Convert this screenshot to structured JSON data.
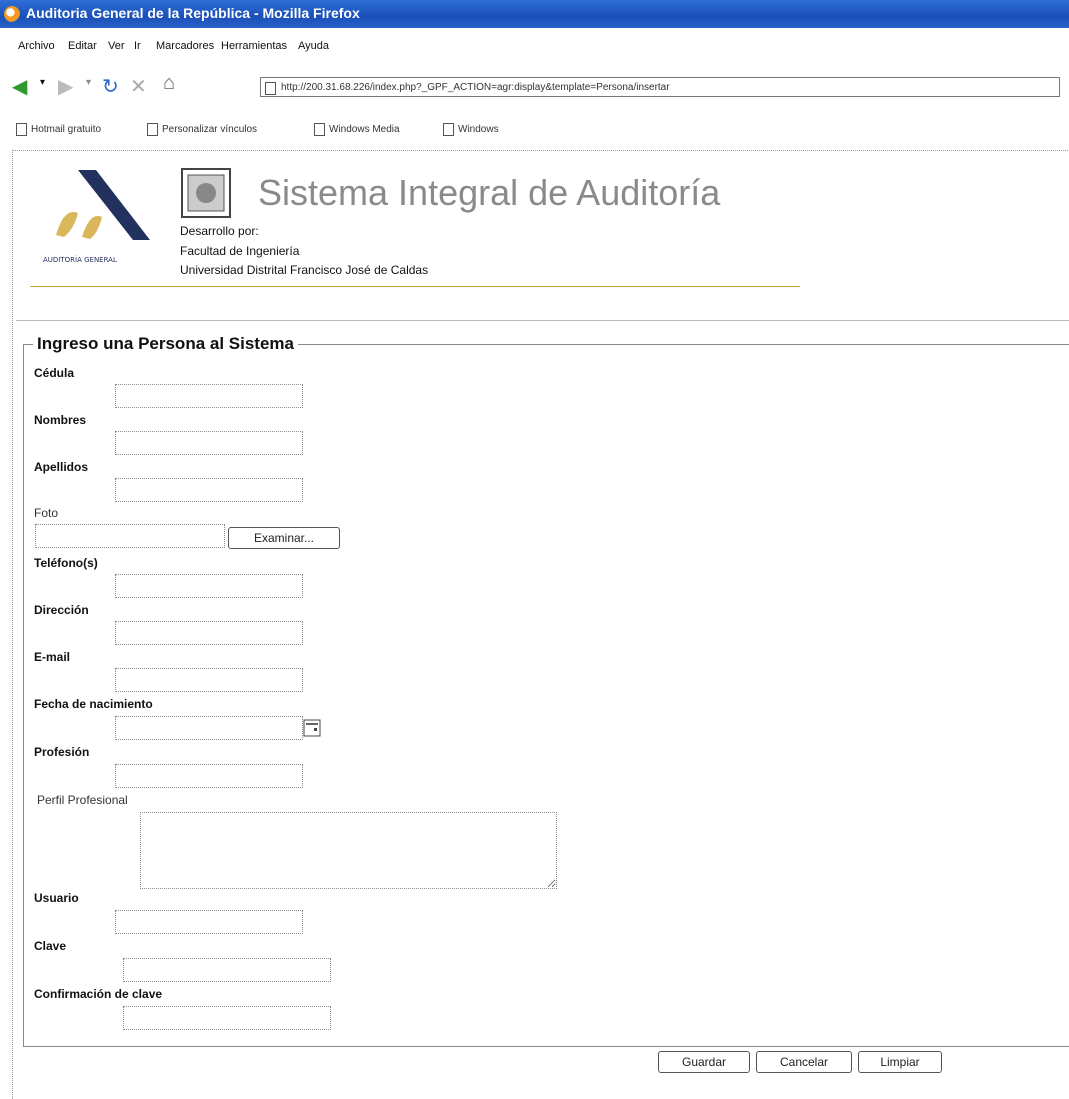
{
  "window": {
    "title": "Auditoria General de la República - Mozilla Firefox"
  },
  "menu": [
    "Archivo",
    "Editar",
    "Ver",
    "Ir",
    "Marcadores",
    "Herramientas",
    "Ayuda"
  ],
  "nav": {
    "url": "http://200.31.68.226/index.php?_GPF_ACTION=agr:display&template=Persona/insertar"
  },
  "bookmarks": [
    "Hotmail gratuito",
    "Personalizar vínculos",
    "Windows Media",
    "Windows"
  ],
  "header": {
    "logo_text": "AUDITORÍA GENERAL",
    "system_title": "Sistema Integral de Auditoría",
    "developed_by": "Desarrollo por:",
    "faculty": "Facultad de Ingeniería",
    "university": "Universidad Distrital Francisco José de Caldas"
  },
  "form": {
    "legend": "Ingreso una Persona al Sistema",
    "fields": {
      "cedula": "Cédula",
      "nombres": "Nombres",
      "apellidos": "Apellidos",
      "foto": "Foto",
      "telefonos": "Teléfono(s)",
      "direccion": "Dirección",
      "email": "E-mail",
      "fecha_nacimiento": "Fecha de nacimiento",
      "profesion": "Profesión",
      "perfil_profesional": "Perfil Profesional",
      "usuario": "Usuario",
      "clave": "Clave",
      "confirmacion_clave": "Confirmación de clave"
    },
    "browse_button": "Examinar...",
    "buttons": {
      "save": "Guardar",
      "cancel": "Cancelar",
      "clear": "Limpiar"
    }
  }
}
